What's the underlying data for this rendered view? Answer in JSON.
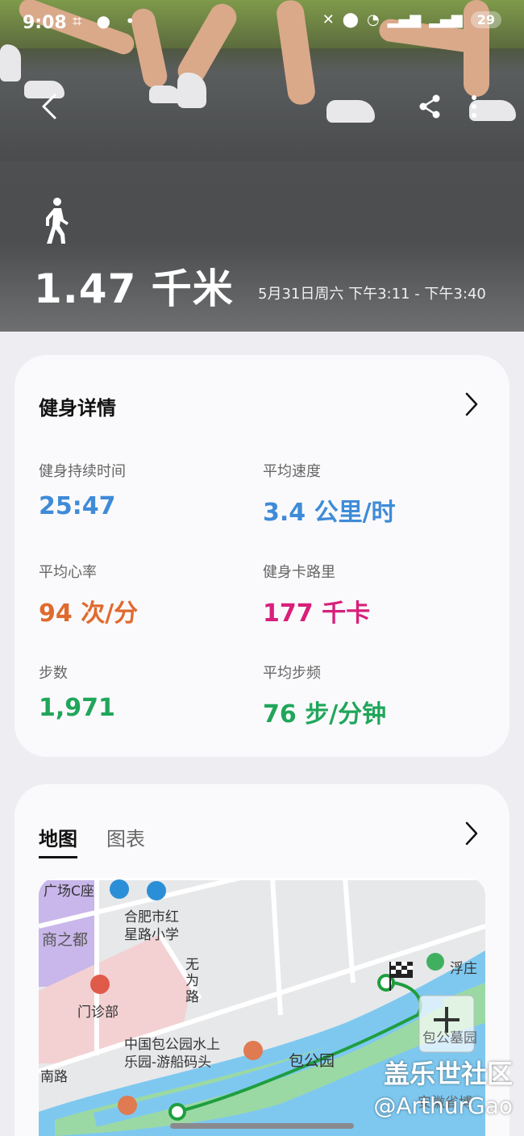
{
  "status_bar": {
    "time": "9:08",
    "battery": "29"
  },
  "hero": {
    "distance": "1.47 千米",
    "time_range": "5月31日周六 下午3:11 - 下午3:40"
  },
  "details_card": {
    "title": "健身详情",
    "metrics": [
      {
        "label": "健身持续时间",
        "value": "25:47",
        "color": "#3f8bd8"
      },
      {
        "label": "平均速度",
        "value": "3.4 公里/时",
        "color": "#3f8bd8"
      },
      {
        "label": "平均心率",
        "value": "94 次/分",
        "color": "#e06a2e"
      },
      {
        "label": "健身卡路里",
        "value": "177 千卡",
        "color": "#d8207a"
      },
      {
        "label": "步数",
        "value": "1,971",
        "color": "#20a65a"
      },
      {
        "label": "平均步频",
        "value": "76 步/分钟",
        "color": "#20a65a"
      }
    ]
  },
  "map_card": {
    "tabs": [
      {
        "label": "地图",
        "active": true
      },
      {
        "label": "图表",
        "active": false
      }
    ],
    "map_labels": {
      "plaza": "广场C座",
      "school": "合肥市红\n星路小学",
      "mall": "商之都",
      "road_wuwei": "无\n为\n路",
      "clinic": "门诊部",
      "fuzhuang": "浮庄",
      "park_pier": "中国包公园水上\n乐园-游船码头",
      "baogong_park": "包公园",
      "tomb": "包公墓园",
      "south_road": "南路",
      "museum": "安徽省博"
    }
  },
  "watermark": {
    "line1": "盖乐世社区",
    "line2": "@ArthurGao"
  }
}
